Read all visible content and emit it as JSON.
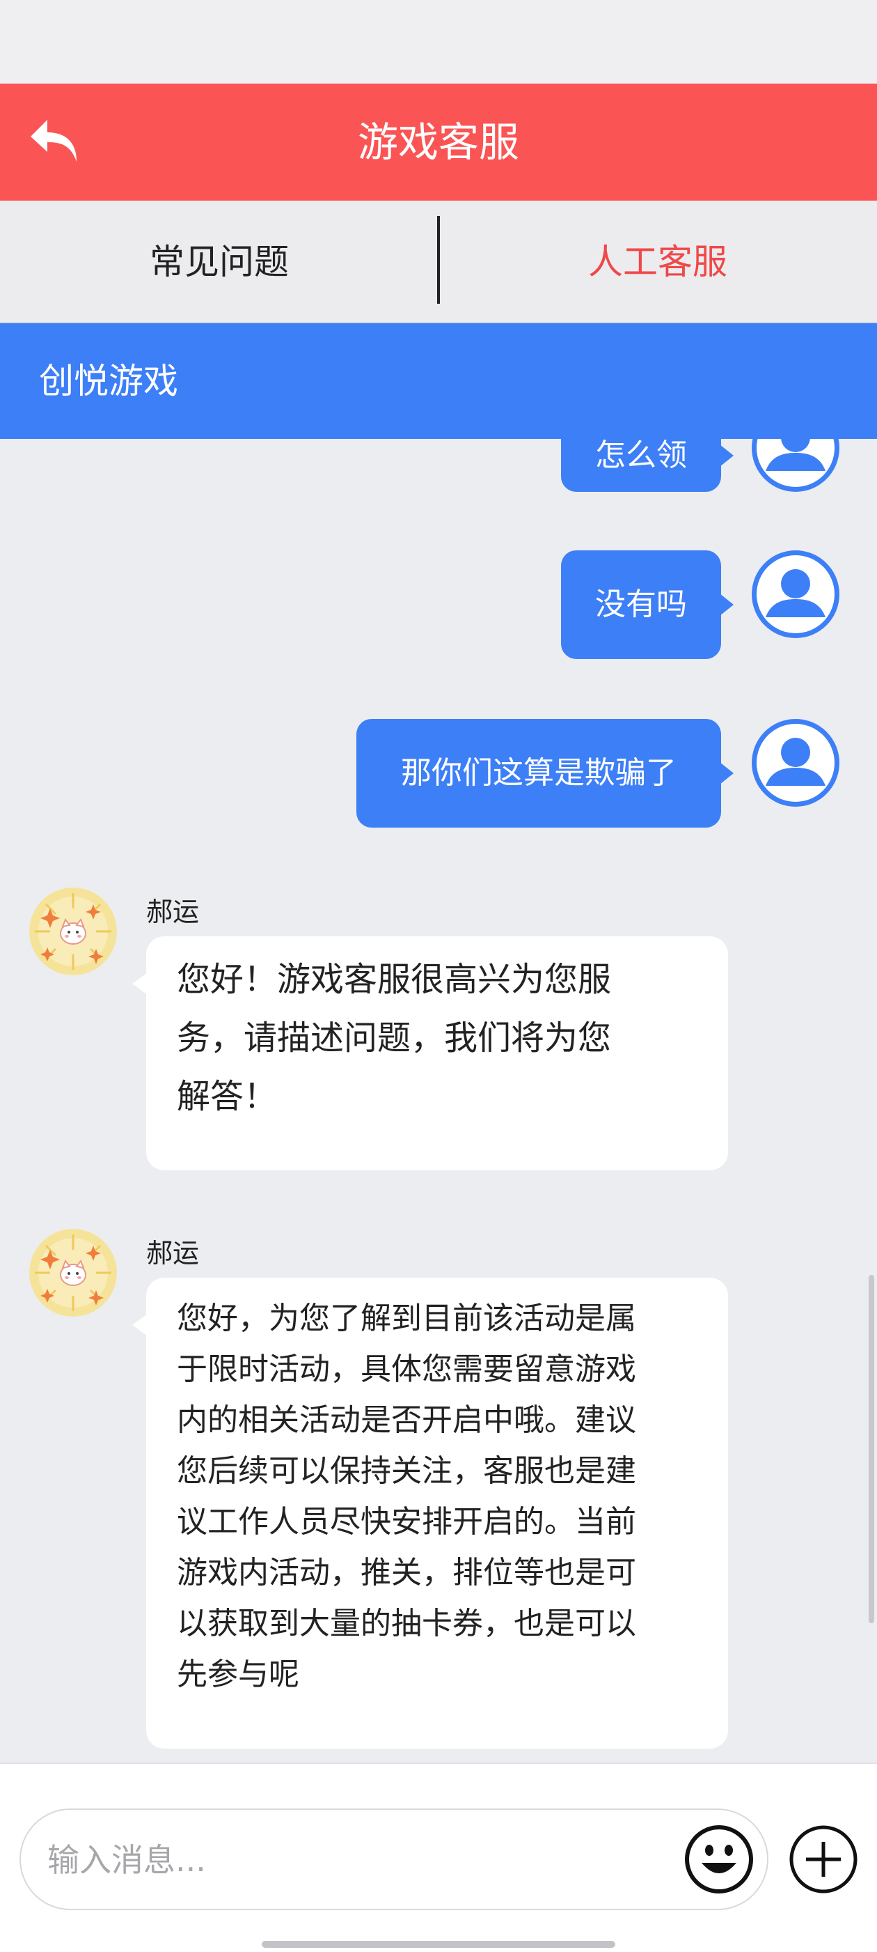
{
  "header": {
    "title": "游戏客服",
    "back_icon": "back-arrow-icon",
    "background": "#fb5454"
  },
  "tabs": [
    {
      "label": "常见问题",
      "active": false
    },
    {
      "label": "人工客服",
      "active": true,
      "color": "#f04848"
    }
  ],
  "group": {
    "title": "创悦游戏",
    "background": "#3d7ff7"
  },
  "messages": [
    {
      "from": "user",
      "text": "怎么领"
    },
    {
      "from": "user",
      "text": "没有吗"
    },
    {
      "from": "user",
      "text": "那你们这算是欺骗了"
    },
    {
      "from": "agent",
      "name": "郝运",
      "lines": [
        "您好！游戏客服很高兴为您服",
        "务，请描述问题，我们将为您",
        "解答！"
      ]
    },
    {
      "from": "agent",
      "name": "郝运",
      "lines": [
        "您好，为您了解到目前该活动是属",
        "于限时活动，具体您需要留意游戏",
        "内的相关活动是否开启中哦。建议",
        "您后续可以保持关注，客服也是建",
        "议工作人员尽快安排开启的。当前",
        "游戏内活动，推关，排位等也是可",
        "以获取到大量的抽卡券，也是可以",
        "先参与呢"
      ]
    }
  ],
  "composer": {
    "placeholder": "输入消息...",
    "emoji_icon": "emoji-icon",
    "plus_icon": "plus-icon"
  }
}
